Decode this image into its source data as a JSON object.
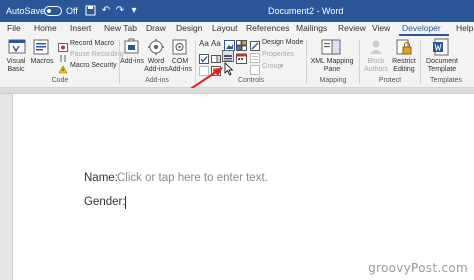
{
  "titlebar": {
    "autosave": "AutoSave",
    "autosave_state": "Off",
    "document_title": "Document2 - Word"
  },
  "tabs": [
    "File",
    "Home",
    "Insert",
    "New Tab",
    "Draw",
    "Design",
    "Layout",
    "References",
    "Mailings",
    "Review",
    "View",
    "Developer",
    "Help"
  ],
  "active_tab": "Developer",
  "ribbon": {
    "code": {
      "visual_basic": "Visual Basic",
      "macros": "Macros",
      "record_macro": "Record Macro",
      "pause_recording": "Pause Recording",
      "macro_security": "Macro Security",
      "group_label": "Code"
    },
    "addins": {
      "add_ins": "Add-ins",
      "word_add_ins": "Word Add-ins",
      "com_add_ins": "COM Add-ins",
      "group_label": "Add-ins"
    },
    "controls": {
      "design_mode": "Design Mode",
      "properties": "Properties",
      "group": "Group",
      "group_label": "Controls"
    },
    "mapping": {
      "xml_mapping_pane": "XML Mapping Pane",
      "group_label": "Mapping"
    },
    "protect": {
      "block_authors": "Block Authors",
      "restrict_editing": "Restrict Editing",
      "group_label": "Protect"
    },
    "templates": {
      "document_template": "Document Template",
      "group_label": "Templates"
    }
  },
  "document": {
    "name_label": "Name:",
    "name_placeholder": "Click or tap here to enter text.",
    "gender_label": "Gender:"
  },
  "watermark": "groovyPost.com",
  "colors": {
    "accent": "#2b579a",
    "annotation_arrow": "#e02020"
  }
}
